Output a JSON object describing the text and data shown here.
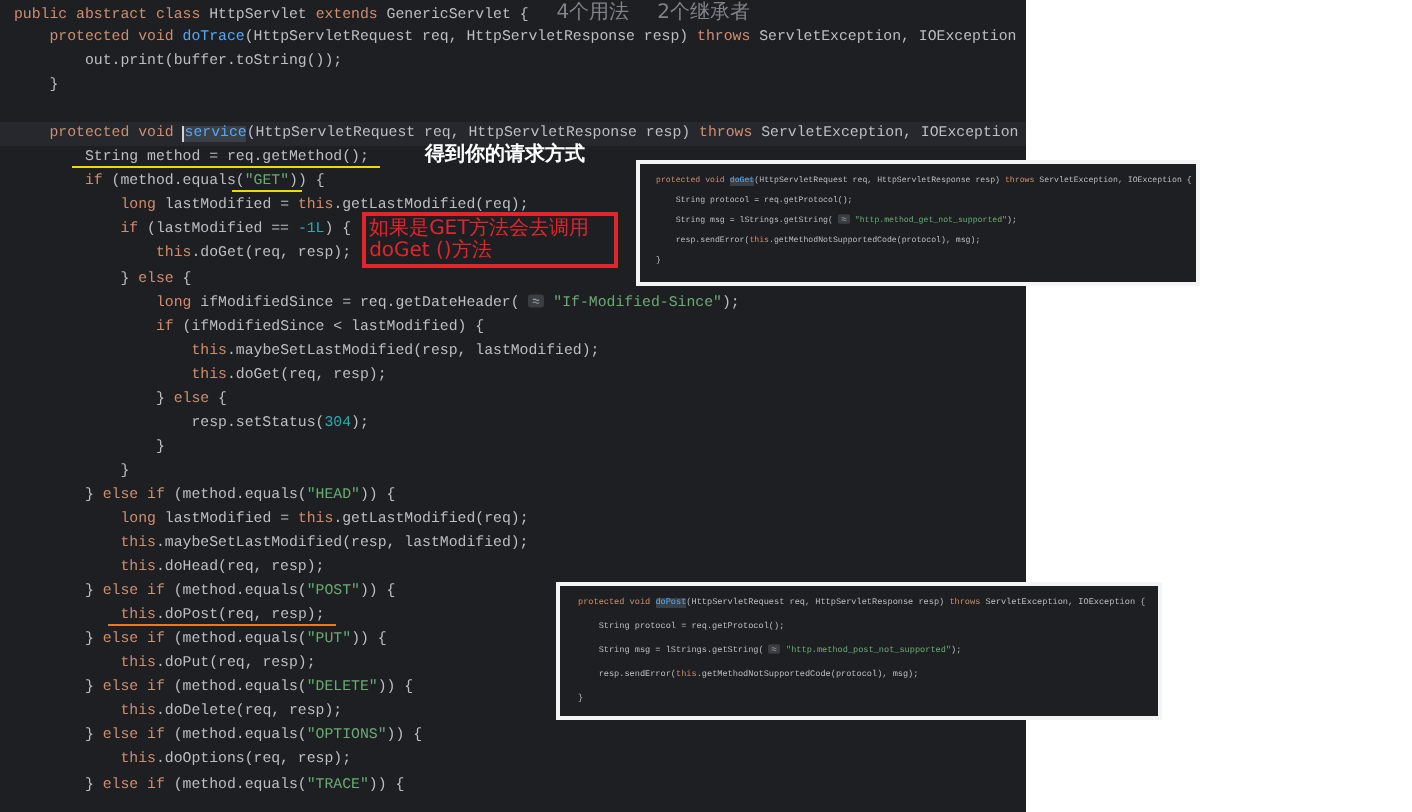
{
  "editor": {
    "lines": [
      {
        "segments": [
          {
            "kind": "keyword",
            "t": "public abstract class "
          },
          {
            "t": "HttpServlet "
          },
          {
            "kind": "keyword",
            "t": "extends "
          },
          {
            "t": "GenericServlet {"
          },
          {
            "kind": "hint",
            "t": "4个用法"
          },
          {
            "kind": "hint",
            "t": "2个继承者"
          }
        ]
      },
      {
        "segments": [
          {
            "kind": "keyword",
            "t": "    protected void "
          },
          {
            "kind": "function",
            "t": "doTrace"
          },
          {
            "t": "(HttpServletRequest req, HttpServletResponse resp) "
          },
          {
            "kind": "keyword",
            "t": "throws "
          },
          {
            "t": "ServletException, IOException"
          }
        ]
      },
      {
        "segments": [
          {
            "t": "        out.print(buffer.toString());"
          }
        ]
      },
      {
        "segments": [
          {
            "t": "    }"
          }
        ]
      },
      {
        "kind": "blank"
      },
      {
        "current": true,
        "segments": [
          {
            "kind": "keyword",
            "t": "    protected void "
          },
          {
            "kind": "highlight",
            "t": "service"
          },
          {
            "t": "(HttpServletRequest req, HttpServletResponse resp) "
          },
          {
            "kind": "keyword",
            "t": "throws "
          },
          {
            "t": "ServletException, IOException"
          }
        ]
      },
      {
        "segments": [
          {
            "t": "        String method = req.getMethod();",
            "underline": {
              "color": "#e8dc00"
            }
          }
        ],
        "note": {
          "kind": "label",
          "text": "得到你的请求方式"
        }
      },
      {
        "segments": [
          {
            "kind": "keyword",
            "t": "        if "
          },
          {
            "t": "(method.equals("
          },
          {
            "kind": "string",
            "t": "\"GET\"",
            "underline": {
              "color": "#e8dc00"
            }
          },
          {
            "t": ")) {"
          }
        ]
      },
      {
        "segments": [
          {
            "kind": "keyword",
            "t": "            long "
          },
          {
            "t": "lastModified = "
          },
          {
            "kind": "keyword",
            "t": "this"
          },
          {
            "t": ".getLastModified(req);"
          }
        ]
      },
      {
        "segments": [
          {
            "kind": "keyword",
            "t": "            if "
          },
          {
            "t": "(lastModified == "
          },
          {
            "kind": "number",
            "t": "-1L"
          },
          {
            "t": ") {"
          }
        ],
        "note": {
          "kind": "callout",
          "text": "如果是GET方法会去调用 doGet ()方法"
        }
      },
      {
        "segments": [
          {
            "kind": "keyword",
            "t": "                this"
          },
          {
            "t": ".doGet(req, resp);"
          }
        ]
      },
      {
        "segments": [
          {
            "t": "            } "
          },
          {
            "kind": "keyword",
            "t": "else "
          },
          {
            "t": "{"
          }
        ]
      },
      {
        "segments": [
          {
            "kind": "keyword",
            "t": "                long "
          },
          {
            "t": "ifModifiedSince = req.getDateHeader( "
          },
          {
            "kind": "chip"
          },
          {
            "kind": "string",
            "t": " \"If-Modified-Since\""
          },
          {
            "t": ");"
          }
        ]
      },
      {
        "segments": [
          {
            "kind": "keyword",
            "t": "                if "
          },
          {
            "t": "(ifModifiedSince < lastModified) {"
          }
        ]
      },
      {
        "segments": [
          {
            "kind": "keyword",
            "t": "                    this"
          },
          {
            "t": ".maybeSetLastModified(resp, lastModified);"
          }
        ]
      },
      {
        "segments": [
          {
            "kind": "keyword",
            "t": "                    this"
          },
          {
            "t": ".doGet(req, resp);"
          }
        ]
      },
      {
        "segments": [
          {
            "t": "                } "
          },
          {
            "kind": "keyword",
            "t": "else "
          },
          {
            "t": "{"
          }
        ]
      },
      {
        "segments": [
          {
            "t": "                    resp.setStatus("
          },
          {
            "kind": "number",
            "t": "304"
          },
          {
            "t": ");"
          }
        ]
      },
      {
        "segments": [
          {
            "t": "                }"
          }
        ]
      },
      {
        "segments": [
          {
            "t": "            }"
          }
        ]
      },
      {
        "segments": [
          {
            "t": "        } "
          },
          {
            "kind": "keyword",
            "t": "else if "
          },
          {
            "t": "(method.equals("
          },
          {
            "kind": "string",
            "t": "\"HEAD\""
          },
          {
            "t": ")) {"
          }
        ]
      },
      {
        "segments": [
          {
            "kind": "keyword",
            "t": "            long "
          },
          {
            "t": "lastModified = "
          },
          {
            "kind": "keyword",
            "t": "this"
          },
          {
            "t": ".getLastModified(req);"
          }
        ]
      },
      {
        "segments": [
          {
            "kind": "keyword",
            "t": "            this"
          },
          {
            "t": ".maybeSetLastModified(resp, lastModified);"
          }
        ]
      },
      {
        "segments": [
          {
            "kind": "keyword",
            "t": "            this"
          },
          {
            "t": ".doHead(req, resp);"
          }
        ]
      },
      {
        "segments": [
          {
            "t": "        } "
          },
          {
            "kind": "keyword",
            "t": "else if "
          },
          {
            "t": "(method.equals("
          },
          {
            "kind": "string",
            "t": "\"POST\""
          },
          {
            "t": ")) {"
          }
        ]
      },
      {
        "segments": [
          {
            "kind": "keyword",
            "t": "            this",
            "underline": {
              "color": "#f07818"
            }
          },
          {
            "t": ".doPost(req, resp);",
            "underline": {
              "color": "#f07818"
            }
          }
        ]
      },
      {
        "segments": [
          {
            "t": "        } "
          },
          {
            "kind": "keyword",
            "t": "else if "
          },
          {
            "t": "(method.equals("
          },
          {
            "kind": "string",
            "t": "\"PUT\""
          },
          {
            "t": ")) {"
          }
        ]
      },
      {
        "segments": [
          {
            "kind": "keyword",
            "t": "            this"
          },
          {
            "t": ".doPut(req, resp);"
          }
        ]
      },
      {
        "segments": [
          {
            "t": "        } "
          },
          {
            "kind": "keyword",
            "t": "else if "
          },
          {
            "t": "(method.equals("
          },
          {
            "kind": "string",
            "t": "\"DELETE\""
          },
          {
            "t": ")) {"
          }
        ]
      },
      {
        "segments": [
          {
            "kind": "keyword",
            "t": "            this"
          },
          {
            "t": ".doDelete(req, resp);"
          }
        ]
      },
      {
        "segments": [
          {
            "t": "        } "
          },
          {
            "kind": "keyword",
            "t": "else if "
          },
          {
            "t": "(method.equals("
          },
          {
            "kind": "string",
            "t": "\"OPTIONS\""
          },
          {
            "t": ")) {"
          }
        ]
      },
      {
        "segments": [
          {
            "kind": "keyword",
            "t": "            this"
          },
          {
            "t": ".doOptions(req, resp);"
          }
        ]
      },
      {
        "segments": [
          {
            "t": "        } "
          },
          {
            "kind": "keyword",
            "t": "else if "
          },
          {
            "t": "(method.equals("
          },
          {
            "kind": "string",
            "t": "\"TRACE\""
          },
          {
            "t": ")) {"
          }
        ]
      }
    ]
  },
  "popups": [
    {
      "lines": [
        {
          "segments": [
            {
              "kind": "keyword",
              "t": "protected void "
            },
            {
              "kind": "highlight",
              "t": "doGet"
            },
            {
              "t": "(HttpServletRequest req, HttpServletResponse resp) "
            },
            {
              "kind": "keyword",
              "t": "throws "
            },
            {
              "t": "ServletException, IOException {"
            }
          ]
        },
        {
          "segments": [
            {
              "t": "    String protocol = req.getProtocol();"
            }
          ]
        },
        {
          "segments": [
            {
              "t": "    String msg = lStrings.getString( "
            },
            {
              "kind": "chip"
            },
            {
              "kind": "string",
              "t": " \"http.method_get_not_supported\""
            },
            {
              "t": ");"
            }
          ]
        },
        {
          "segments": [
            {
              "t": "    resp.sendError("
            },
            {
              "kind": "keyword",
              "t": "this"
            },
            {
              "t": ".getMethodNotSupportedCode(protocol), msg);"
            }
          ]
        },
        {
          "segments": [
            {
              "t": "}"
            }
          ]
        }
      ]
    },
    {
      "lines": [
        {
          "segments": [
            {
              "kind": "keyword",
              "t": "protected void "
            },
            {
              "kind": "highlight",
              "t": "doPost"
            },
            {
              "t": "(HttpServletRequest req, HttpServletResponse resp) "
            },
            {
              "kind": "keyword",
              "t": "throws "
            },
            {
              "t": "ServletException, IOException {"
            }
          ]
        },
        {
          "segments": [
            {
              "t": "    String protocol = req.getProtocol();"
            }
          ]
        },
        {
          "segments": [
            {
              "t": "    String msg = lStrings.getString( "
            },
            {
              "kind": "chip"
            },
            {
              "kind": "string",
              "t": " \"http.method_post_not_supported\""
            },
            {
              "t": ");"
            }
          ]
        },
        {
          "segments": [
            {
              "t": "    resp.sendError("
            },
            {
              "kind": "keyword",
              "t": "this"
            },
            {
              "t": ".getMethodNotSupportedCode(protocol), msg);"
            }
          ]
        },
        {
          "segments": [
            {
              "t": "}"
            }
          ]
        }
      ]
    }
  ]
}
